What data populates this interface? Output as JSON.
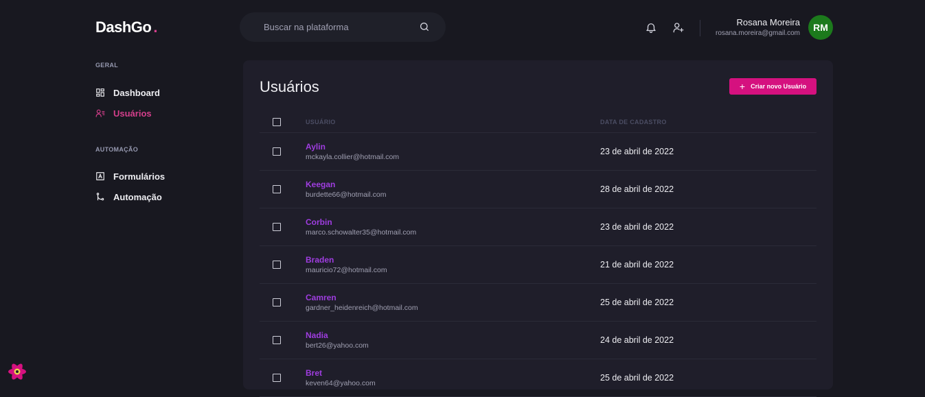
{
  "header": {
    "logo_text": "DashGo",
    "logo_dot": ".",
    "search_placeholder": "Buscar na plataforma",
    "search_icon": "search-icon",
    "notification_icon": "bell-icon",
    "add_user_icon": "user-plus-icon",
    "profile": {
      "name": "Rosana Moreira",
      "email": "rosana.moreira@gmail.com",
      "initials": "RM"
    }
  },
  "sidebar": {
    "sections": [
      {
        "title": "GERAL",
        "items": [
          {
            "label": "Dashboard",
            "icon": "dashboard-icon",
            "active": false
          },
          {
            "label": "Usuários",
            "icon": "users-icon",
            "active": true
          }
        ]
      },
      {
        "title": "AUTOMAÇÃO",
        "items": [
          {
            "label": "Formulários",
            "icon": "form-icon",
            "active": false
          },
          {
            "label": "Automação",
            "icon": "git-merge-icon",
            "active": false
          }
        ]
      }
    ]
  },
  "main": {
    "title": "Usuários",
    "create_button": "Criar novo Usuário",
    "table": {
      "columns": [
        "USUÁRIO",
        "DATA DE CADASTRO"
      ],
      "rows": [
        {
          "name": "Aylin",
          "email": "mckayla.collier@hotmail.com",
          "date": "23 de abril de 2022"
        },
        {
          "name": "Keegan",
          "email": "burdette66@hotmail.com",
          "date": "28 de abril de 2022"
        },
        {
          "name": "Corbin",
          "email": "marco.schowalter35@hotmail.com",
          "date": "23 de abril de 2022"
        },
        {
          "name": "Braden",
          "email": "mauricio72@hotmail.com",
          "date": "21 de abril de 2022"
        },
        {
          "name": "Camren",
          "email": "gardner_heidenreich@hotmail.com",
          "date": "25 de abril de 2022"
        },
        {
          "name": "Nadia",
          "email": "bert26@yahoo.com",
          "date": "24 de abril de 2022"
        },
        {
          "name": "Bret",
          "email": "keven64@yahoo.com",
          "date": "25 de abril de 2022"
        }
      ]
    }
  },
  "colors": {
    "background": "#181820",
    "panel": "#1f1e2a",
    "accent": "#d53f8c",
    "user_name": "#9f3de0",
    "avatar": "#1c7a1c"
  },
  "devtools_icon": "react-devtools-icon"
}
